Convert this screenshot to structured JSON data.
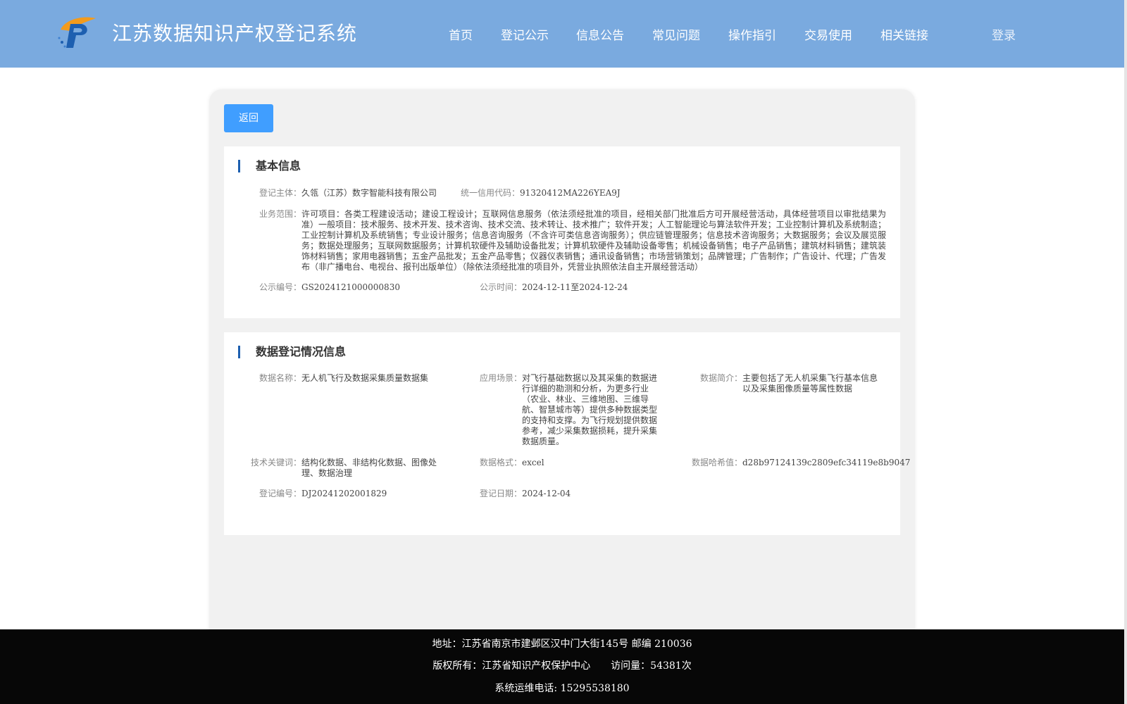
{
  "header": {
    "site_title": "江苏数据知识产权登记系统",
    "nav": [
      "首页",
      "登记公示",
      "信息公告",
      "常见问题",
      "操作指引",
      "交易使用",
      "相关链接"
    ],
    "login": "登录"
  },
  "back_button": "返回",
  "basic_info": {
    "title": "基本信息",
    "subject_label": "登记主体：",
    "subject_value": "久瓴（江苏）数字智能科技有限公司",
    "credit_label": "统一信用代码：",
    "credit_value": "91320412MA226YEA9J",
    "scope_label": "业务范围：",
    "scope_value": "许可项目：各类工程建设活动；建设工程设计；互联网信息服务（依法须经批准的项目，经相关部门批准后方可开展经营活动，具体经营项目以审批结果为准）一般项目：技术服务、技术开发、技术咨询、技术交流、技术转让、技术推广；软件开发；人工智能理论与算法软件开发；工业控制计算机及系统制造；工业控制计算机及系统销售；专业设计服务；信息咨询服务（不含许可类信息咨询服务）；供应链管理服务；信息技术咨询服务；大数据服务；会议及展览服务；数据处理服务；互联网数据服务；计算机软硬件及辅助设备批发；计算机软硬件及辅助设备零售；机械设备销售；电子产品销售；建筑材料销售；建筑装饰材料销售；家用电器销售；五金产品批发；五金产品零售；仪器仪表销售；通讯设备销售；市场营销策划；品牌管理；广告制作；广告设计、代理；广告发布（非广播电台、电视台、报刊出版单位）（除依法须经批准的项目外，凭营业执照依法自主开展经营活动）",
    "pub_no_label": "公示编号：",
    "pub_no_value": "GS2024121000000830",
    "pub_time_label": "公示时间：",
    "pub_time_value": "2024-12-11至2024-12-24"
  },
  "data_info": {
    "title": "数据登记情况信息",
    "name_label": "数据名称：",
    "name_value": "无人机飞行及数据采集质量数据集",
    "scene_label": "应用场景：",
    "scene_value": "对飞行基础数据以及其采集的数据进行详细的勘测和分析，为更多行业（农业、林业、三维地图、三维导航、智慧城市等）提供多种数据类型的支持和支撑。为飞行规划提供数据参考，减少采集数据损耗，提升采集数据质量。",
    "intro_label": "数据简介：",
    "intro_value": "主要包括了无人机采集飞行基本信息以及采集图像质量等属性数据",
    "keywords_label": "技术关键词：",
    "keywords_value": "结构化数据、非结构化数据、图像处理、数据治理",
    "format_label": "数据格式：",
    "format_value": "excel",
    "hash_label": "数据哈希值：",
    "hash_value": "d28b97124139c2809efc34119e8b9047",
    "reg_no_label": "登记编号：",
    "reg_no_value": "DJ20241202001829",
    "reg_date_label": "登记日期：",
    "reg_date_value": "2024-12-04"
  },
  "footer": {
    "address": "地址：江苏省南京市建邺区汉中门大街145号 邮编 210036",
    "copyright": "版权所有：江苏省知识产权保护中心",
    "visits": "访问量：54381次",
    "phone": "系统运维电话: 15295538180"
  },
  "colors": {
    "header_bg": "#7aaadf",
    "primary_button": "#409eff",
    "title_bar": "#1d5fb0",
    "footer_bg": "#070707"
  }
}
